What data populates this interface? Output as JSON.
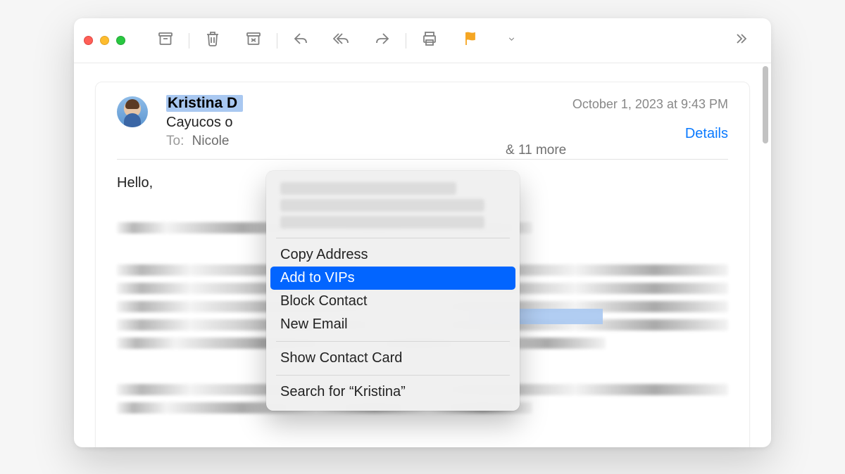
{
  "header": {
    "sender_name": "Kristina D",
    "subject": "Cayucos o",
    "to_label": "To:",
    "recipient": "Nicole",
    "more_recipients": "& 11 more",
    "timestamp": "October 1, 2023 at 9:43 PM",
    "details_label": "Details"
  },
  "body": {
    "greeting": "Hello,"
  },
  "context_menu": {
    "copy_address": "Copy Address",
    "add_to_vips": "Add to VIPs",
    "block_contact": "Block Contact",
    "new_email": "New Email",
    "show_contact_card": "Show Contact Card",
    "search_for": "Search for “Kristina”"
  }
}
